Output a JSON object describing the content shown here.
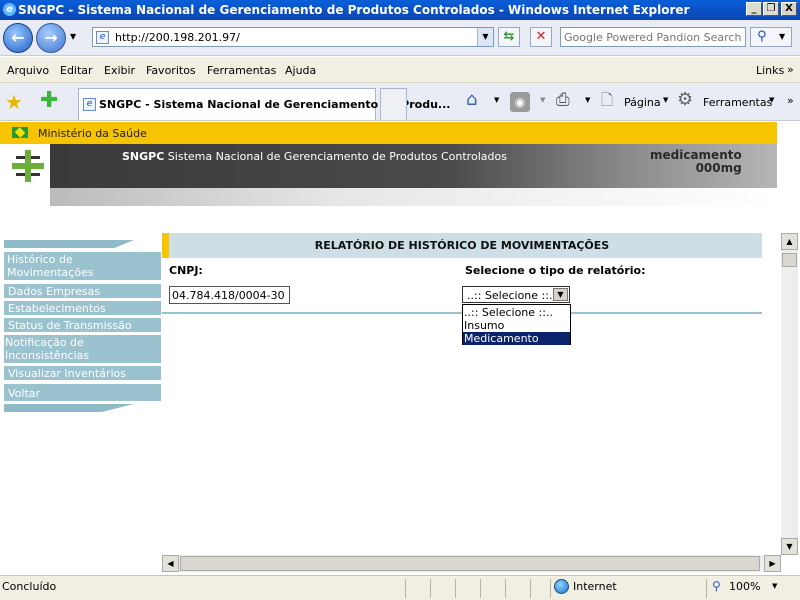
{
  "window": {
    "title": "SNGPC - Sistema Nacional de Gerenciamento de Produtos Controlados - Windows Internet Explorer",
    "controls": {
      "minimize": "_",
      "maximize": "❐",
      "close": "X"
    }
  },
  "nav": {
    "back_icon": "←",
    "forward_icon": "→",
    "address": "http://200.198.201.97/",
    "search_placeholder": "Google Powered Pandion Search"
  },
  "menu": {
    "items": [
      "Arquivo",
      "Editar",
      "Exibir",
      "Favoritos",
      "Ferramentas",
      "Ajuda"
    ],
    "links": "Links"
  },
  "tabs": {
    "active_label": "SNGPC - Sistema Nacional de Gerenciamento de Produ...",
    "page_label": "Página",
    "tools_label": "Ferramentas"
  },
  "page": {
    "ministry": "Ministério da Saúde",
    "banner_brand": "SNGPC",
    "banner_subtitle": "Sistema Nacional de Gerenciamento de Produtos Controlados",
    "banner_product_line1": "medicamento",
    "banner_product_line2": "000mg"
  },
  "sidebar": {
    "items": [
      "Histórico de Movimentações",
      "Dados Empresas",
      "Estabelecimentos",
      "Status de Transmissão",
      "Notificação de Inconsistências",
      "Visualizar Inventários",
      "Voltar"
    ]
  },
  "report": {
    "title": "RELATÓRIO DE HISTÓRICO DE MOVIMENTAÇÕES",
    "cnpj_label": "CNPJ:",
    "cnpj_value": "04.784.418/0004-30",
    "type_label": "Selecione o tipo de relatório:",
    "selected": "..:: Selecione ::..",
    "options": [
      "..:: Selecione ::..",
      "Insumo",
      "Medicamento"
    ],
    "highlighted_option": "Medicamento"
  },
  "status": {
    "text": "Concluído",
    "zone": "Internet",
    "zoom": "100%"
  },
  "colors": {
    "titlebar": "#0b4fc2",
    "yellow": "#f6c400",
    "sidebar": "#9ac3cf",
    "highlight": "#0a246a"
  }
}
